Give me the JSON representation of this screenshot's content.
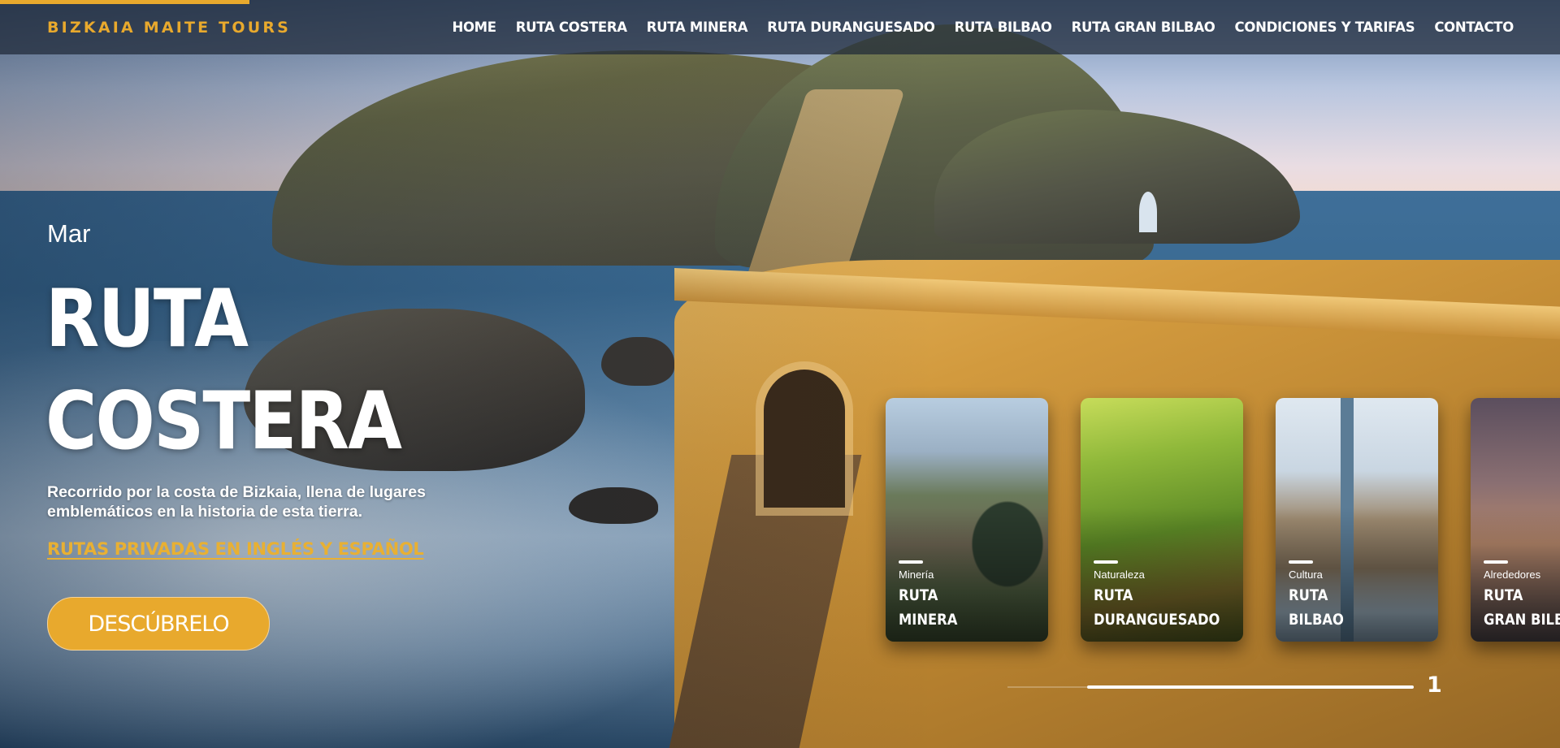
{
  "header": {
    "logo": "BIZKAIA MAITE TOURS",
    "nav": [
      {
        "label": "HOME"
      },
      {
        "label": "RUTA COSTERA"
      },
      {
        "label": "RUTA MINERA"
      },
      {
        "label": "RUTA DURANGUESADO"
      },
      {
        "label": "RUTA BILBAO"
      },
      {
        "label": "RUTA GRAN BILBAO"
      },
      {
        "label": "CONDICIONES Y TARIFAS"
      },
      {
        "label": "CONTACTO"
      }
    ]
  },
  "hero": {
    "eyebrow": "Mar",
    "title_line1": "RUTA",
    "title_line2": "COSTERA",
    "description": "Recorrido por la costa de Bizkaia, llena de lugares emblemáticos en la historia de esta tierra.",
    "link": "RUTAS PRIVADAS EN INGLÉS Y ESPAÑOL",
    "cta": "DESCÚBRELO",
    "background": "coastal stone bridge to island at sea"
  },
  "cards": [
    {
      "category": "Minería",
      "title_line1": "RUTA",
      "title_line2": "MINERA"
    },
    {
      "category": "Naturaleza",
      "title_line1": "RUTA",
      "title_line2": "DURANGUESADO"
    },
    {
      "category": "Cultura",
      "title_line1": "RUTA",
      "title_line2": "BILBAO"
    },
    {
      "category": "Alrededores",
      "title_line1": "RUTA",
      "title_line2": "GRAN BILBAO"
    }
  ],
  "pagination": {
    "current": "1"
  },
  "colors": {
    "accent": "#e8a92d",
    "header_bg": "#1e2837",
    "text": "#ffffff"
  }
}
